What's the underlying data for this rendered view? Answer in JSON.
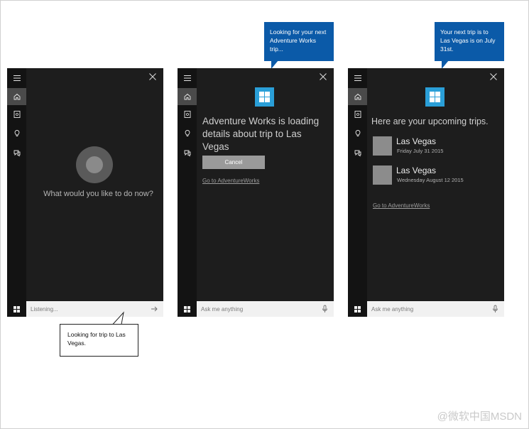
{
  "panels": [
    {
      "id": "listening",
      "prompt": "What would you like to do now?",
      "search_value": "Listening..."
    },
    {
      "id": "loading",
      "message": "Adventure Works is loading details about trip to Las Vegas",
      "cancel_label": "Cancel",
      "link": "Go to AdventureWorks",
      "search_placeholder": "Ask me anything"
    },
    {
      "id": "trips",
      "title": "Here are your upcoming trips.",
      "trips": [
        {
          "name": "Las Vegas",
          "date": "Friday July 31 2015"
        },
        {
          "name": "Las Vegas",
          "date": "Wednesday August 12 2015"
        }
      ],
      "link": "Go to AdventureWorks",
      "search_placeholder": "Ask me anything"
    }
  ],
  "callouts": {
    "user": "Looking for trip to Las Vegas.",
    "cortana_1": "Looking for your next Adventure Works trip...",
    "cortana_2": "Your next trip is to Las Vegas is on July 31st."
  },
  "watermark": "@微软中国MSDN",
  "colors": {
    "panel_bg": "#1d1d1d",
    "rail_bg": "#131313",
    "accent": "#2a9fd8",
    "callout_blue": "#0b5aa8"
  }
}
